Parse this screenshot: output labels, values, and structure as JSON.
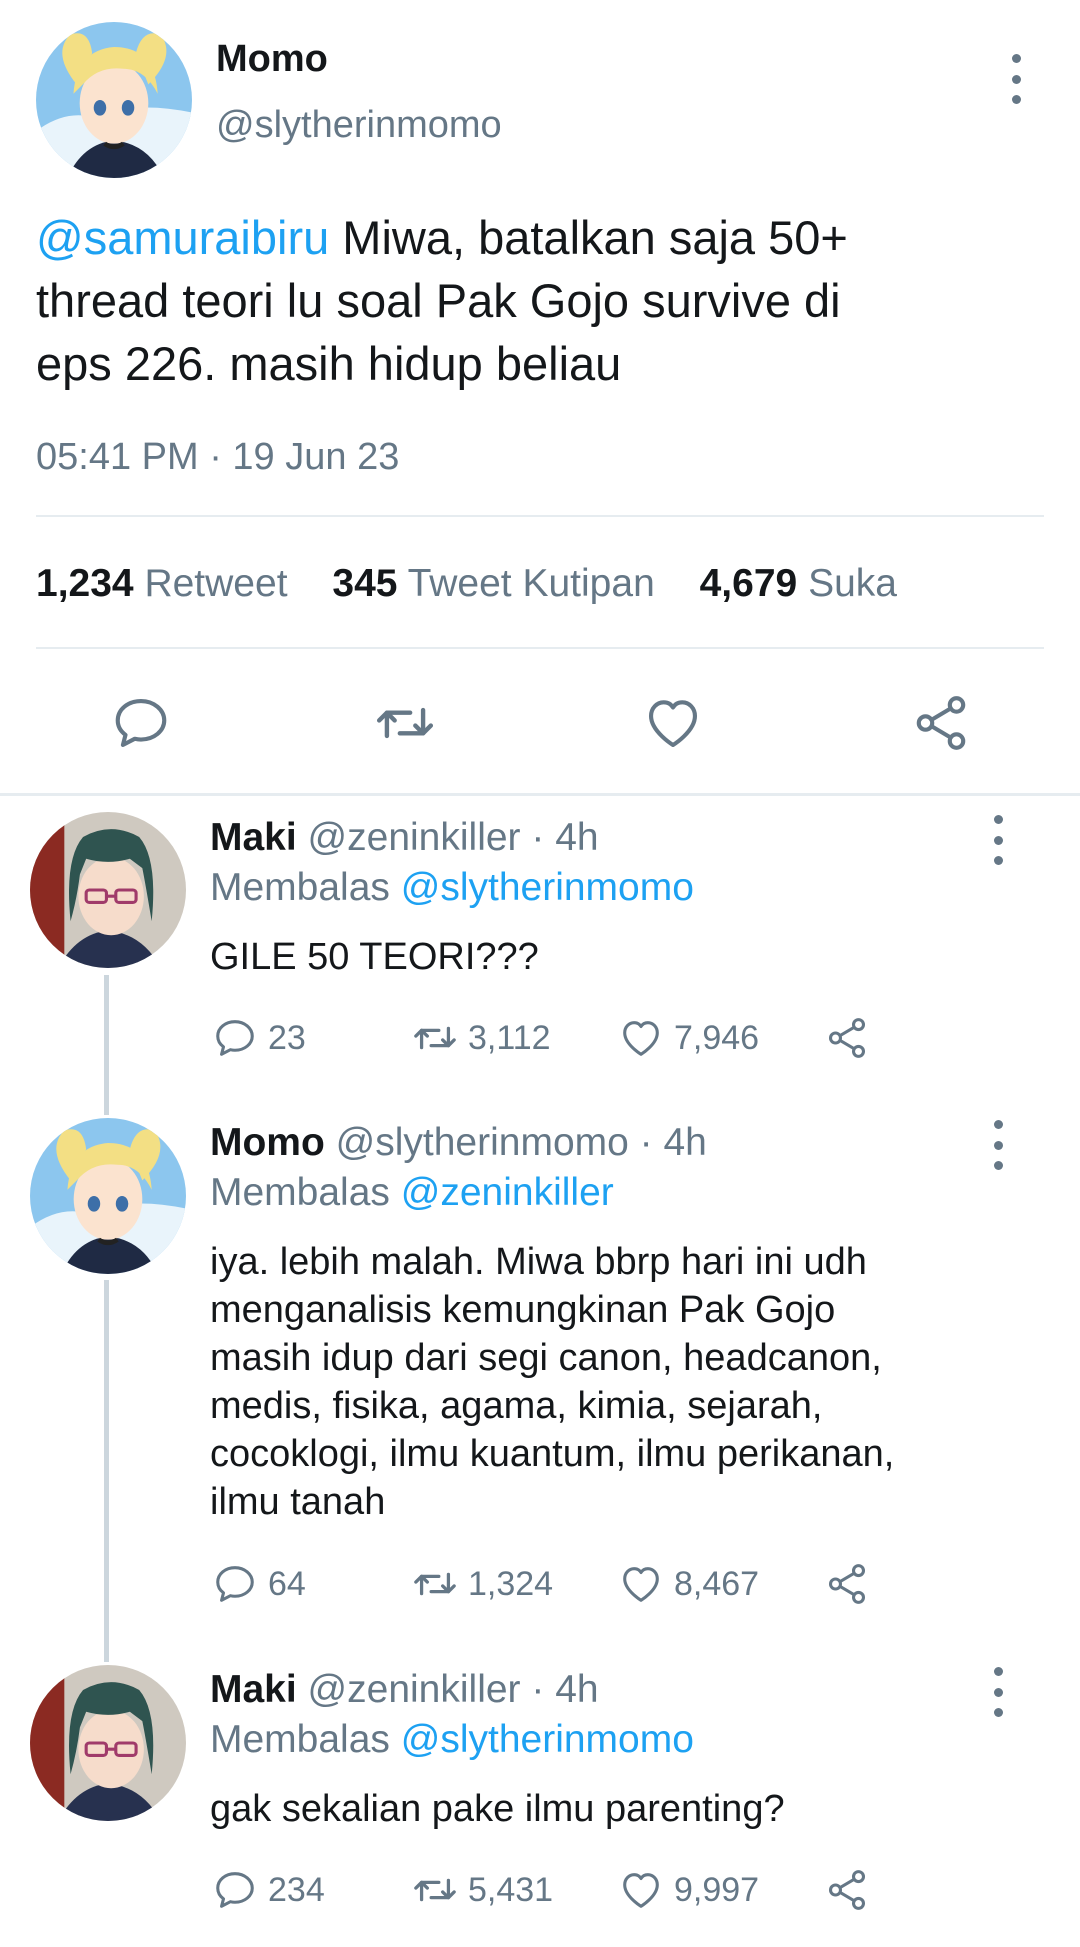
{
  "main_tweet": {
    "author_name": "Momo",
    "author_handle": "@slytherinmomo",
    "mention": "@samuraibiru",
    "text_line1": " Miwa, batalkan saja 50+",
    "text_line2": "thread teori lu soal Pak Gojo survive di",
    "text_line3": "eps 226. masih hidup beliau",
    "timestamp": "05:41 PM · 19 Jun 23",
    "stats": {
      "retweet_count": "1,234",
      "retweet_label": "Retweet",
      "quote_count": "345",
      "quote_label": "Tweet Kutipan",
      "like_count": "4,679",
      "like_label": "Suka"
    }
  },
  "replies": [
    {
      "name": "Maki",
      "meta": "@zeninkiller · 4h",
      "replying_label": "Membalas",
      "replying_to": "@slytherinmomo",
      "lines": [
        "GILE 50 TEORI???"
      ],
      "reply_count": "23",
      "retweet_count": "3,112",
      "like_count": "7,946"
    },
    {
      "name": "Momo",
      "meta": "@slytherinmomo · 4h",
      "replying_label": "Membalas",
      "replying_to": "@zeninkiller",
      "lines": [
        "iya. lebih malah. Miwa bbrp hari ini udh",
        "menganalisis kemungkinan Pak Gojo",
        "masih idup dari segi canon, headcanon,",
        "medis, fisika, agama, kimia, sejarah,",
        "cocoklogi, ilmu kuantum, ilmu perikanan,",
        "ilmu tanah"
      ],
      "reply_count": "64",
      "retweet_count": "1,324",
      "like_count": "8,467"
    },
    {
      "name": "Maki",
      "meta": "@zeninkiller · 4h",
      "replying_label": "Membalas",
      "replying_to": "@slytherinmomo",
      "lines": [
        "gak sekalian pake ilmu parenting?"
      ],
      "reply_count": "234",
      "retweet_count": "5,431",
      "like_count": "9,997"
    }
  ],
  "colors": {
    "link": "#1da1f2",
    "muted": "#657786",
    "text": "#14171a",
    "divider": "#e6ecf0"
  },
  "icons": [
    "more-vertical-icon",
    "reply-icon",
    "retweet-icon",
    "like-icon",
    "share-icon"
  ]
}
